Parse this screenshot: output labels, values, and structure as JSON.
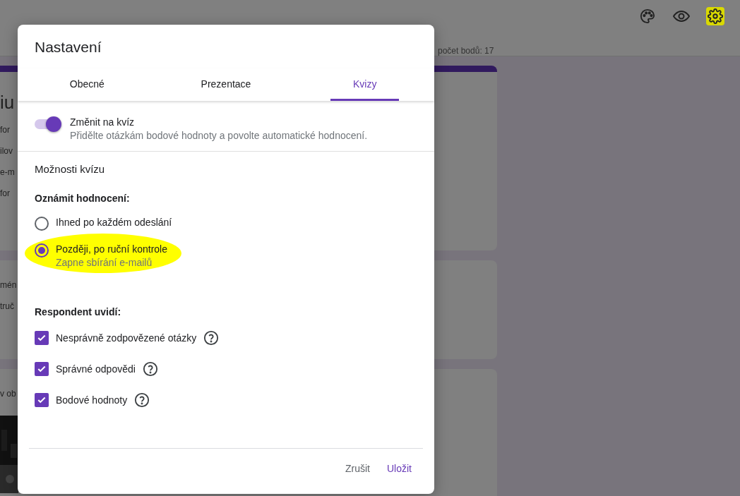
{
  "header": {
    "points": "počet bodů: 17",
    "gear_highlighted": true
  },
  "background_cards": [
    {
      "texts": [
        "iu",
        "for",
        "ilov",
        "e-m",
        "for"
      ]
    },
    {
      "texts": [
        "mén",
        "truč"
      ]
    },
    {
      "texts": [
        "v ob"
      ],
      "kind": "picture"
    }
  ],
  "dialog": {
    "title": "Nastavení",
    "tabs": [
      {
        "label": "Obecné",
        "selected": false
      },
      {
        "label": "Prezentace",
        "selected": false
      },
      {
        "label": "Kvizy",
        "selected": true
      }
    ],
    "quiz_toggle": {
      "label": "Změnit na kvíz",
      "description": "Přidělte otázkám bodové hodnoty a povolte automatické hodnocení.",
      "on": true
    },
    "section_title": "Možnosti kvízu",
    "release_heading": "Oznámit hodnocení:",
    "release_options": [
      {
        "label": "Ihned po každém odeslání",
        "selected": false,
        "highlighted": false
      },
      {
        "label": "Později, po ruční kontrole",
        "hint": "Zapne sbírání e-mailů",
        "selected": true,
        "highlighted": true
      }
    ],
    "respondent_heading": "Respondent uvidí:",
    "respondent_options": [
      {
        "label": "Nesprávně zodpovězené otázky",
        "checked": true
      },
      {
        "label": "Správné odpovědi",
        "checked": true
      },
      {
        "label": "Bodové hodnoty",
        "checked": true
      }
    ],
    "buttons": [
      "Zrušit",
      "Uložit"
    ]
  }
}
